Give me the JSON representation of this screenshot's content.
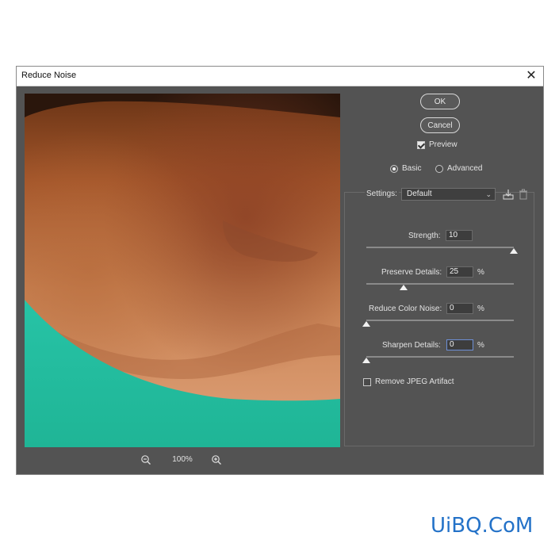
{
  "dialog": {
    "title": "Reduce Noise"
  },
  "buttons": {
    "ok": "OK",
    "cancel": "Cancel"
  },
  "preview": {
    "label": "Preview",
    "checked": true
  },
  "mode": {
    "basic": "Basic",
    "advanced": "Advanced",
    "selected": "Basic"
  },
  "settings": {
    "label": "Settings:",
    "value": "Default"
  },
  "sliders": [
    {
      "label": "Strength:",
      "value": "10",
      "unit": "",
      "max": 10
    },
    {
      "label": "Preserve Details:",
      "value": "25",
      "unit": "%",
      "max": 100
    },
    {
      "label": "Reduce Color Noise:",
      "value": "0",
      "unit": "%",
      "max": 100
    },
    {
      "label": "Sharpen Details:",
      "value": "0",
      "unit": "%",
      "max": 100
    }
  ],
  "jpeg": {
    "label": "Remove JPEG Artifact",
    "checked": false
  },
  "zoom": {
    "level": "100%"
  },
  "watermark": "UiBQ.CoM",
  "colors": {
    "dialog_bg": "#535353",
    "skin": "#c98a5a",
    "shirt": "#2bbfa3"
  }
}
